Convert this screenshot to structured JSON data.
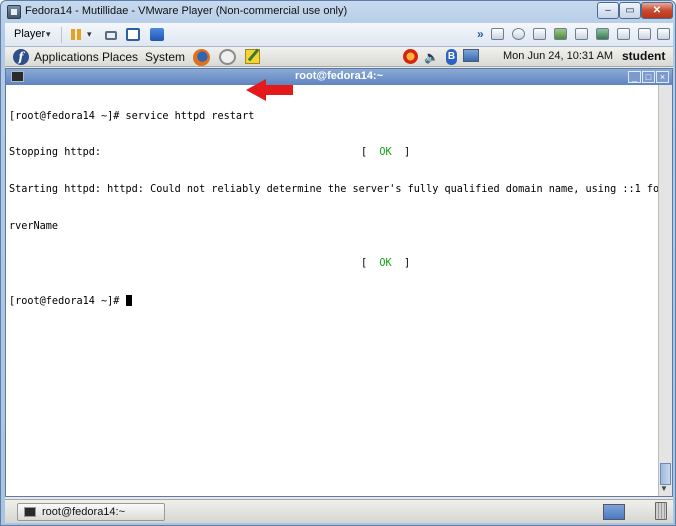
{
  "vm_window": {
    "title": "Fedora14 - Mutillidae - VMware Player (Non-commercial use only)",
    "controls": {
      "minimize": "–",
      "maximize": "▭",
      "close": "✕"
    }
  },
  "player_toolbar": {
    "player_label": "Player",
    "dropdown_glyph": "▾",
    "more_glyph": "»"
  },
  "gnome_panel": {
    "menus": [
      "Applications",
      "Places",
      "System"
    ],
    "fedora_glyph": "f",
    "volume_glyph": "🔈",
    "bluetooth_glyph": "B",
    "clock": "Mon Jun 24, 10:31 AM",
    "user": "student"
  },
  "terminal": {
    "title": "root@fedora14:~",
    "controls": {
      "minimize": "_",
      "maximize": "□",
      "close": "×"
    },
    "lines": [
      {
        "text": "[root@fedora14 ~]# service httpd restart"
      },
      {
        "text": "Stopping httpd:",
        "status_open": "[  ",
        "status": "OK",
        "status_close": "  ]"
      },
      {
        "text": "Starting httpd: httpd: Could not reliably determine the server's fully qualified domain name, using ::1 for Se"
      },
      {
        "text": "rverName"
      },
      {
        "text": "",
        "status_open": "[  ",
        "status": "OK",
        "status_close": "  ]"
      },
      {
        "text": "[root@fedora14 ~]# "
      }
    ],
    "scroll_down_glyph": "▼"
  },
  "bottom_panel": {
    "taskbar_item": "root@fedora14:~"
  },
  "colors": {
    "ok_green": "#12a312",
    "annotation_red": "#e3191c",
    "terminal_title_bg": "#5f85c0"
  },
  "icons": [
    "app-icon",
    "pause-icon",
    "network-icon",
    "fullscreen-icon",
    "unity-icon",
    "fedora-icon",
    "firefox-icon",
    "mail-icon",
    "notes-icon",
    "update-icon",
    "volume-icon",
    "bluetooth-icon",
    "display-icon",
    "terminal-icon",
    "workspace-icon",
    "trash-icon"
  ]
}
